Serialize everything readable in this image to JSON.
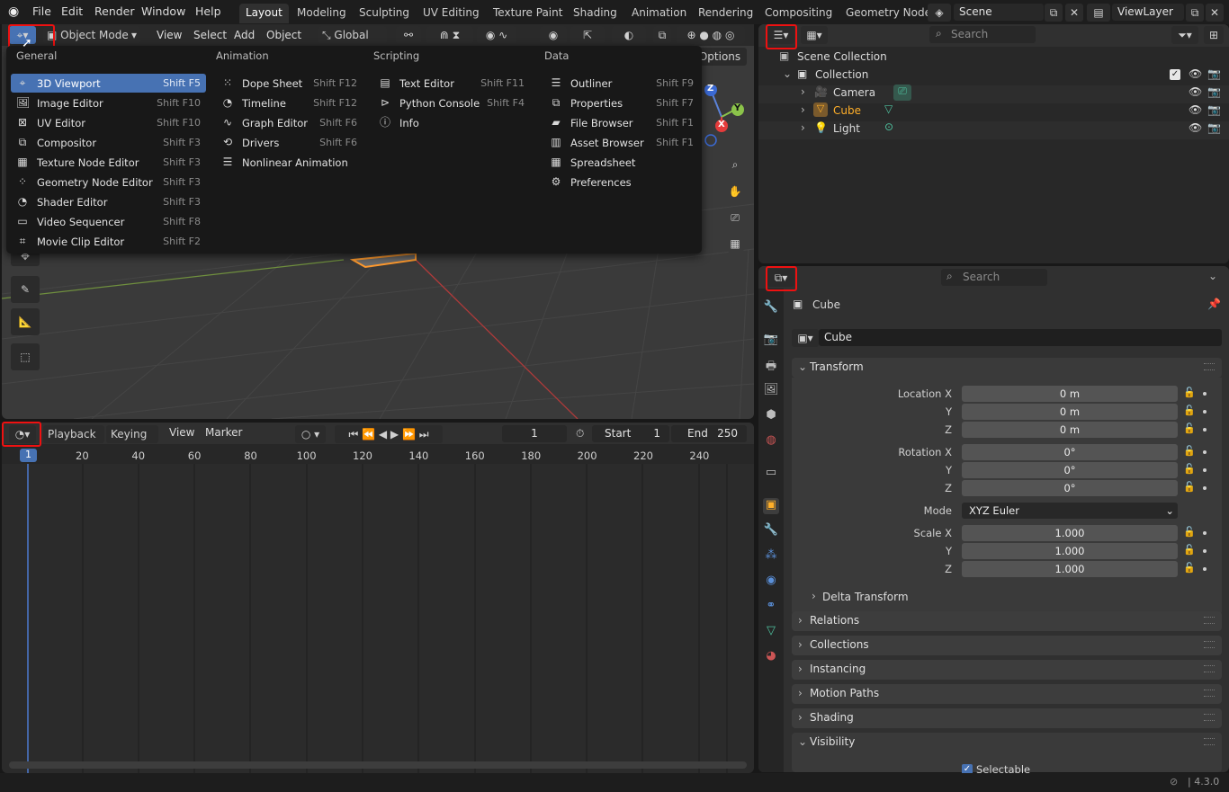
{
  "topbar": {
    "menus": [
      "File",
      "Edit",
      "Render",
      "Window",
      "Help"
    ],
    "workspaces": [
      "Layout",
      "Modeling",
      "Sculpting",
      "UV Editing",
      "Texture Paint",
      "Shading",
      "Animation",
      "Rendering",
      "Compositing",
      "Geometry Node"
    ],
    "scene": "Scene",
    "view_layer": "ViewLayer"
  },
  "viewport_header": {
    "mode": "Object Mode",
    "menus": [
      "View",
      "Select",
      "Add",
      "Object"
    ],
    "orientation": "Global",
    "options": "Options"
  },
  "editor_menu": {
    "columns": [
      {
        "title": "General",
        "items": [
          {
            "label": "3D Viewport",
            "shortcut": "Shift F5",
            "icon": "viewport-3d-icon",
            "selected": true
          },
          {
            "label": "Image Editor",
            "shortcut": "Shift F10",
            "icon": "image-editor-icon"
          },
          {
            "label": "UV Editor",
            "shortcut": "Shift F10",
            "icon": "uv-editor-icon"
          },
          {
            "label": "Compositor",
            "shortcut": "Shift F3",
            "icon": "compositor-icon"
          },
          {
            "label": "Texture Node Editor",
            "shortcut": "Shift F3",
            "icon": "texture-node-icon"
          },
          {
            "label": "Geometry Node Editor",
            "shortcut": "Shift F3",
            "icon": "geometry-node-icon"
          },
          {
            "label": "Shader Editor",
            "shortcut": "Shift F3",
            "icon": "shader-editor-icon"
          },
          {
            "label": "Video Sequencer",
            "shortcut": "Shift F8",
            "icon": "video-sequencer-icon"
          },
          {
            "label": "Movie Clip Editor",
            "shortcut": "Shift F2",
            "icon": "movie-clip-icon"
          }
        ]
      },
      {
        "title": "Animation",
        "items": [
          {
            "label": "Dope Sheet",
            "shortcut": "Shift F12",
            "icon": "dope-sheet-icon"
          },
          {
            "label": "Timeline",
            "shortcut": "Shift F12",
            "icon": "timeline-icon"
          },
          {
            "label": "Graph Editor",
            "shortcut": "Shift F6",
            "icon": "graph-editor-icon"
          },
          {
            "label": "Drivers",
            "shortcut": "Shift F6",
            "icon": "drivers-icon"
          },
          {
            "label": "Nonlinear Animation",
            "shortcut": "",
            "icon": "nla-icon"
          }
        ]
      },
      {
        "title": "Scripting",
        "items": [
          {
            "label": "Text Editor",
            "shortcut": "Shift F11",
            "icon": "text-editor-icon"
          },
          {
            "label": "Python Console",
            "shortcut": "Shift F4",
            "icon": "python-console-icon"
          },
          {
            "label": "Info",
            "shortcut": "",
            "icon": "info-icon"
          }
        ]
      },
      {
        "title": "Data",
        "items": [
          {
            "label": "Outliner",
            "shortcut": "Shift F9",
            "icon": "outliner-icon"
          },
          {
            "label": "Properties",
            "shortcut": "Shift F7",
            "icon": "properties-icon"
          },
          {
            "label": "File Browser",
            "shortcut": "Shift F1",
            "icon": "file-browser-icon"
          },
          {
            "label": "Asset Browser",
            "shortcut": "Shift F1",
            "icon": "asset-browser-icon"
          },
          {
            "label": "Spreadsheet",
            "shortcut": "",
            "icon": "spreadsheet-icon"
          },
          {
            "label": "Preferences",
            "shortcut": "",
            "icon": "preferences-icon"
          }
        ]
      }
    ]
  },
  "outliner": {
    "search_placeholder": "Search",
    "root": "Scene Collection",
    "collection": "Collection",
    "items": [
      {
        "label": "Camera",
        "active": false
      },
      {
        "label": "Cube",
        "active": true
      },
      {
        "label": "Light",
        "active": false
      }
    ]
  },
  "properties": {
    "search_placeholder": "Search",
    "object_name": "Cube",
    "datablock_name": "Cube",
    "transform_title": "Transform",
    "location": {
      "label": "Location X",
      "values": [
        "0 m",
        "0 m",
        "0 m"
      ]
    },
    "rotation": {
      "label": "Rotation X",
      "values": [
        "0°",
        "0°",
        "0°"
      ]
    },
    "mode": {
      "label": "Mode",
      "value": "XYZ Euler"
    },
    "scale": {
      "label": "Scale X",
      "values": [
        "1.000",
        "1.000",
        "1.000"
      ]
    },
    "axis_y": "Y",
    "axis_z": "Z",
    "delta": "Delta Transform",
    "panels": [
      "Relations",
      "Collections",
      "Instancing",
      "Motion Paths",
      "Shading",
      "Visibility"
    ],
    "selectable": "Selectable"
  },
  "timeline": {
    "menus": [
      "Playback",
      "Keying",
      "View",
      "Marker"
    ],
    "current_frame": "1",
    "start_label": "Start",
    "start": "1",
    "end_label": "End",
    "end": "250",
    "ticks": [
      "20",
      "40",
      "60",
      "80",
      "100",
      "120",
      "140",
      "160",
      "180",
      "200",
      "220",
      "240"
    ],
    "cursor": "1"
  },
  "statusbar": {
    "version": "4.3.0"
  },
  "gizmo": {
    "z": "Z",
    "y": "Y",
    "x": "X"
  },
  "colors": {
    "accent": "#4772b3",
    "active_object": "#ffaf29",
    "highlight": "#e11"
  }
}
